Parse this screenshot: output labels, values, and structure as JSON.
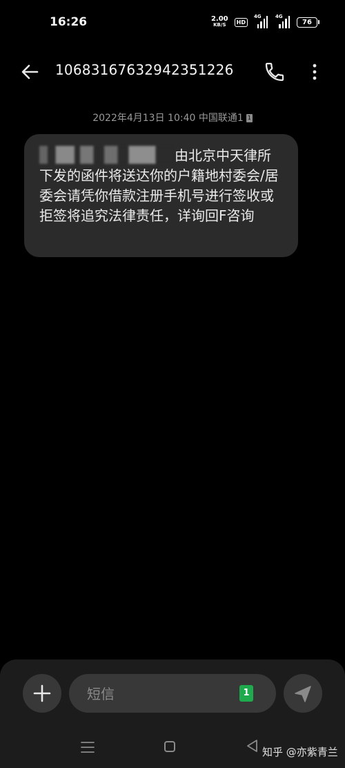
{
  "status_bar": {
    "time": "16:26",
    "net_speed_value": "2.00",
    "net_speed_unit": "KB/S",
    "hd_label": "HD",
    "signal1_label": "4G",
    "signal2_label": "4G",
    "battery": "76"
  },
  "header": {
    "title": "1068316763294235​1226"
  },
  "message": {
    "meta": "2022年4月13日 10:40 中国联通1",
    "sim_badge": "1",
    "body": "由北京中天律所下发的函件将送达你的户籍地村委会/居委会请凭你借款注册手机号进行签收或拒签将追究法律责任，详询回F咨询"
  },
  "compose": {
    "placeholder": "短信",
    "sim_label": "1"
  },
  "watermark": "知乎 @亦紫青兰",
  "colors": {
    "background": "#000000",
    "bubble": "#2b2b2b",
    "panel": "#1c1c1c",
    "control": "#383838",
    "sim_green": "#1faa4e"
  }
}
